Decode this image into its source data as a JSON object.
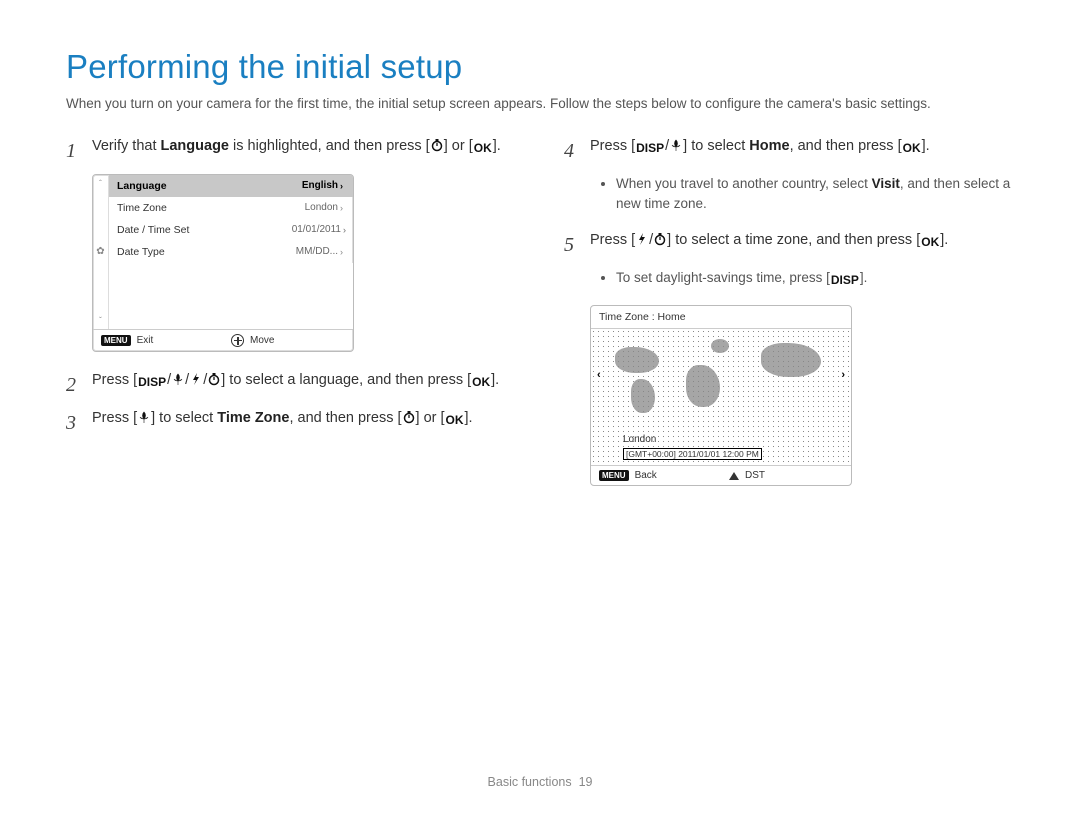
{
  "title": "Performing the initial setup",
  "intro": "When you turn on your camera for the first time, the initial setup screen appears. Follow the steps below to configure the camera's basic settings.",
  "icons": {
    "disp": "DISP",
    "ok": "OK",
    "menu": "MENU"
  },
  "steps": {
    "s1": {
      "pre": "Verify that ",
      "bold1": "Language",
      "mid": " is highlighted, and then press [",
      "post": "] or ["
    },
    "s2": {
      "pre": "Press [",
      "mid": "] to select a language, and then press ["
    },
    "s3": {
      "pre": "Press [",
      "mid": "] to select ",
      "bold1": "Time Zone",
      "post": ", and then press ["
    },
    "s4": {
      "pre": "Press [",
      "mid": "] to select ",
      "bold1": "Home",
      "post": ", and then press ["
    },
    "s4b": {
      "text_a": "When you travel to another country, select ",
      "bold": "Visit",
      "text_b": ", and then select a new time zone."
    },
    "s5": {
      "pre": "Press [",
      "mid": "] to select a time zone, and then press ["
    },
    "s5b": {
      "text_a": "To set daylight-savings time, press [",
      "text_b": "]."
    },
    "bracket_close": "].",
    "or_text": "] or ["
  },
  "screen1": {
    "rows": [
      {
        "label": "Language",
        "value": "English"
      },
      {
        "label": "Time Zone",
        "value": "London"
      },
      {
        "label": "Date / Time Set",
        "value": "01/01/2011"
      },
      {
        "label": "Date Type",
        "value": "MM/DD..."
      }
    ],
    "footer": {
      "exit": "Exit",
      "move": "Move"
    }
  },
  "screen2": {
    "title": "Time Zone : Home",
    "city": "London",
    "gmt": "[GMT+00:00] 2011/01/01 12:00 PM",
    "footer": {
      "back": "Back",
      "dst": "DST"
    }
  },
  "footer": {
    "section": "Basic functions",
    "page": "19"
  }
}
